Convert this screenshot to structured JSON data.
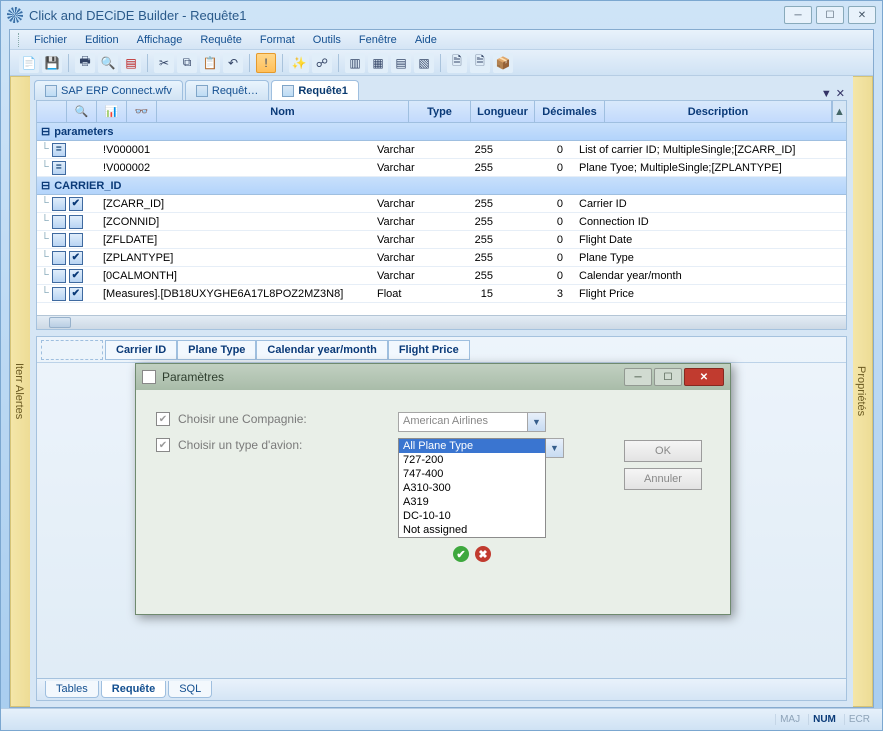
{
  "window": {
    "title": "Click and DECiDE Builder - Requête1"
  },
  "menus": [
    "Fichier",
    "Edition",
    "Affichage",
    "Requête",
    "Format",
    "Outils",
    "Fenêtre",
    "Aide"
  ],
  "side_panels": {
    "left": "Iterr Alertes",
    "right": "Propriétés"
  },
  "filetabs": {
    "items": [
      {
        "label": "SAP ERP Connect.wfv",
        "active": false
      },
      {
        "label": "Requêt…",
        "active": false
      },
      {
        "label": "Requête1",
        "active": true
      }
    ],
    "dropdown": "▼",
    "close": "✕"
  },
  "grid": {
    "headers": {
      "nom": "Nom",
      "type": "Type",
      "longueur": "Longueur",
      "decimales": "Décimales",
      "description": "Description"
    },
    "sections": [
      {
        "name": "parameters",
        "rows": [
          {
            "marks": [
              "eq"
            ],
            "name": "!V000001",
            "type": "Varchar",
            "len": "255",
            "dec": "0",
            "desc": "List of carrier ID; MultipleSingle;[ZCARR_ID]"
          },
          {
            "marks": [
              "eq"
            ],
            "name": "!V000002",
            "type": "Varchar",
            "len": "255",
            "dec": "0",
            "desc": "Plane Tyoe; MultipleSingle;[ZPLANTYPE]"
          }
        ]
      },
      {
        "name": "CARRIER_ID",
        "rows": [
          {
            "marks": [
              "",
              "v"
            ],
            "name": "[ZCARR_ID]",
            "type": "Varchar",
            "len": "255",
            "dec": "0",
            "desc": "Carrier ID"
          },
          {
            "marks": [
              "",
              ""
            ],
            "name": "[ZCONNID]",
            "type": "Varchar",
            "len": "255",
            "dec": "0",
            "desc": "Connection ID"
          },
          {
            "marks": [
              "",
              ""
            ],
            "name": "[ZFLDATE]",
            "type": "Varchar",
            "len": "255",
            "dec": "0",
            "desc": "Flight Date"
          },
          {
            "marks": [
              "",
              "v"
            ],
            "name": "[ZPLANTYPE]",
            "type": "Varchar",
            "len": "255",
            "dec": "0",
            "desc": "Plane Type"
          },
          {
            "marks": [
              "",
              "v"
            ],
            "name": "[0CALMONTH]",
            "type": "Varchar",
            "len": "255",
            "dec": "0",
            "desc": "Calendar year/month"
          },
          {
            "marks": [
              "",
              "v"
            ],
            "name": "[Measures].[DB18UXYGHE6A17L8POZ2MZ3N8]",
            "type": "Float",
            "len": "15",
            "dec": "3",
            "desc": "Flight Price"
          }
        ]
      }
    ]
  },
  "pivot": [
    "Carrier ID",
    "Plane Type",
    "Calendar year/month",
    "Flight Price"
  ],
  "bottom_tabs": [
    "Tables",
    "Requête",
    "SQL"
  ],
  "bottom_active": 1,
  "status": {
    "maj": "MAJ",
    "num": "NUM",
    "ecr": "ECR"
  },
  "dialog": {
    "title": "Paramètres",
    "row1": {
      "label": "Choisir une Compagnie:",
      "value": "American Airlines"
    },
    "row2": {
      "label": "Choisir un type d'avion:",
      "options": [
        "All Plane Type",
        "727-200",
        "747-400",
        "A310-300",
        "A319",
        "DC-10-10",
        "Not assigned"
      ],
      "selected": 0
    },
    "ok": "OK",
    "cancel": "Annuler"
  }
}
